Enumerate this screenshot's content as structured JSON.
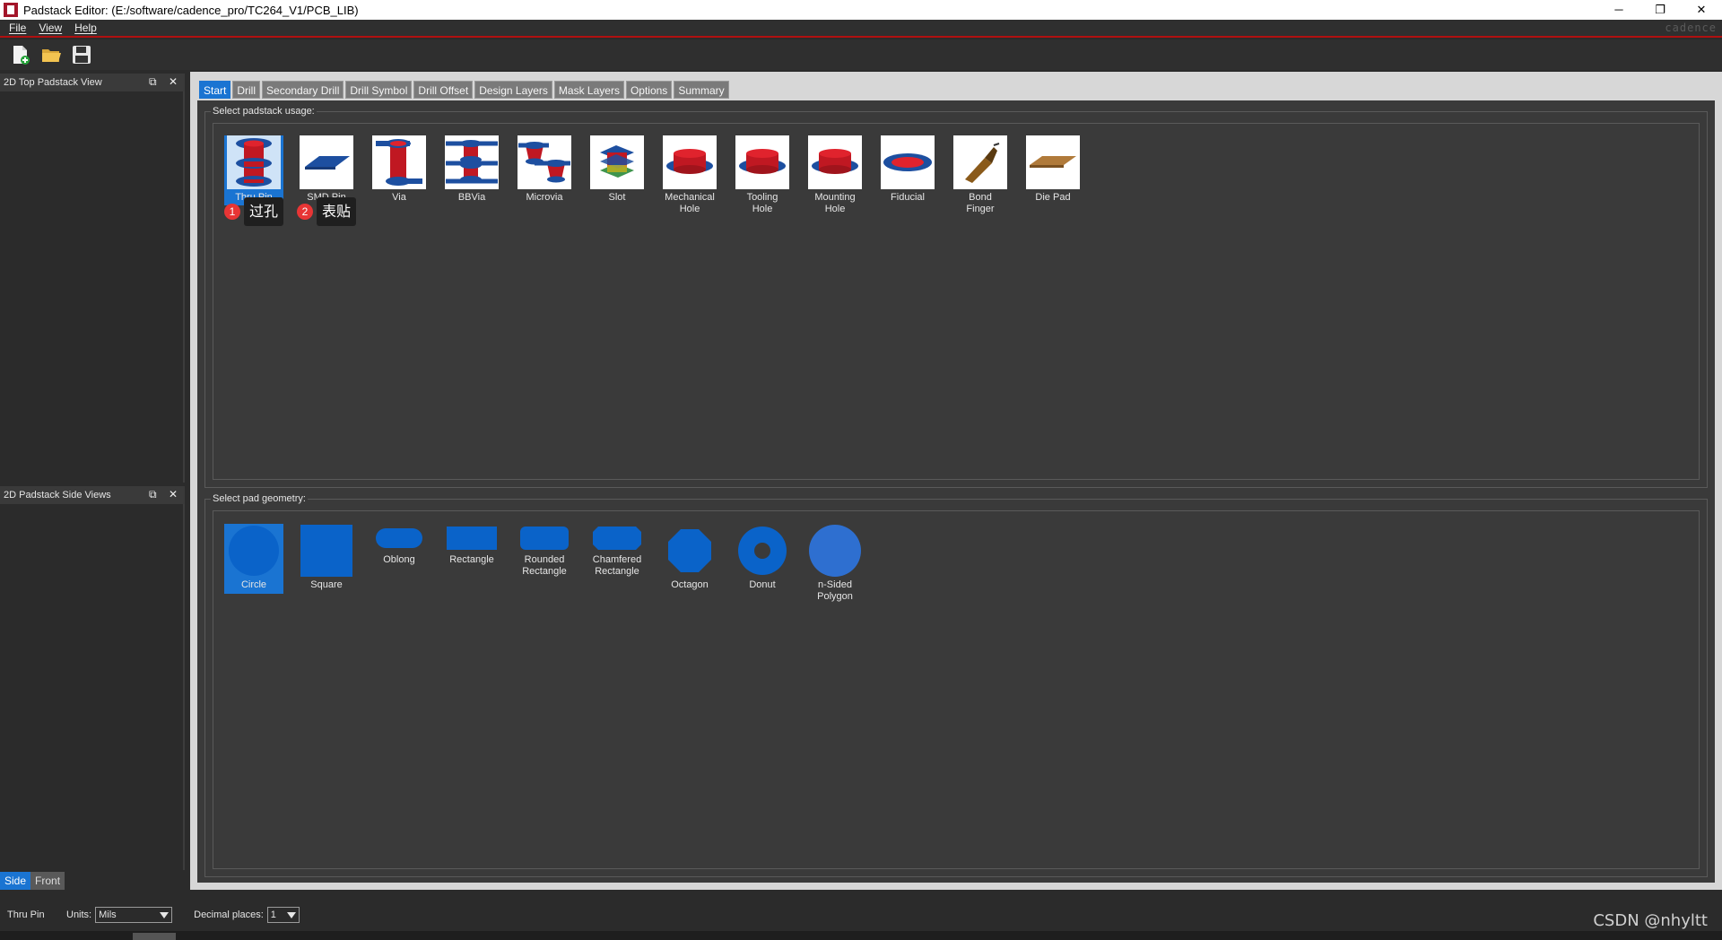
{
  "window": {
    "title": "Padstack Editor:   (E:/software/cadence_pro/TC264_V1/PCB_LIB)",
    "controls": [
      "─",
      "❐",
      "✕"
    ]
  },
  "menu": {
    "items": [
      "File",
      "View",
      "Help"
    ],
    "logo": "cadence"
  },
  "toolbar": {
    "icons": [
      "new-file-icon",
      "open-folder-icon",
      "save-icon"
    ]
  },
  "left_panels": {
    "top_title": "2D Top Padstack View",
    "side_title": "2D Padstack Side Views",
    "float_glyph": "⧉",
    "close_glyph": "✕",
    "side_tabs": [
      "Side",
      "Front"
    ]
  },
  "tabs": [
    "Start",
    "Drill",
    "Secondary Drill",
    "Drill Symbol",
    "Drill Offset",
    "Design Layers",
    "Mask Layers",
    "Options",
    "Summary"
  ],
  "usage": {
    "label": "Select padstack usage:",
    "items": [
      {
        "line1": "Thru Pin",
        "line2": ""
      },
      {
        "line1": "SMD Pin",
        "line2": ""
      },
      {
        "line1": "Via",
        "line2": ""
      },
      {
        "line1": "BBVia",
        "line2": ""
      },
      {
        "line1": "Microvia",
        "line2": ""
      },
      {
        "line1": "Slot",
        "line2": ""
      },
      {
        "line1": "Mechanical",
        "line2": "Hole"
      },
      {
        "line1": "Tooling",
        "line2": "Hole"
      },
      {
        "line1": "Mounting",
        "line2": "Hole"
      },
      {
        "line1": "Fiducial",
        "line2": ""
      },
      {
        "line1": "Bond",
        "line2": "Finger"
      },
      {
        "line1": "Die Pad",
        "line2": ""
      }
    ]
  },
  "annotations": [
    {
      "num": "1",
      "text": "过孔"
    },
    {
      "num": "2",
      "text": "表贴"
    }
  ],
  "geometry": {
    "label": "Select pad geometry:",
    "items": [
      {
        "line1": "Circle",
        "line2": ""
      },
      {
        "line1": "Square",
        "line2": ""
      },
      {
        "line1": "Oblong",
        "line2": ""
      },
      {
        "line1": "Rectangle",
        "line2": ""
      },
      {
        "line1": "Rounded",
        "line2": "Rectangle"
      },
      {
        "line1": "Chamfered",
        "line2": "Rectangle"
      },
      {
        "line1": "Octagon",
        "line2": ""
      },
      {
        "line1": "Donut",
        "line2": ""
      },
      {
        "line1": "n-Sided",
        "line2": "Polygon"
      }
    ]
  },
  "status": {
    "mode": "Thru Pin",
    "units_label": "Units:",
    "units_value": "Mils",
    "decimal_label": "Decimal places:",
    "decimal_value": "1"
  },
  "watermark": "CSDN @nhyltt",
  "colors": {
    "accent": "#1a74d2",
    "pad_blue": "#0a63c9",
    "pad_red": "#d8141c",
    "annotation_red": "#e83535"
  }
}
